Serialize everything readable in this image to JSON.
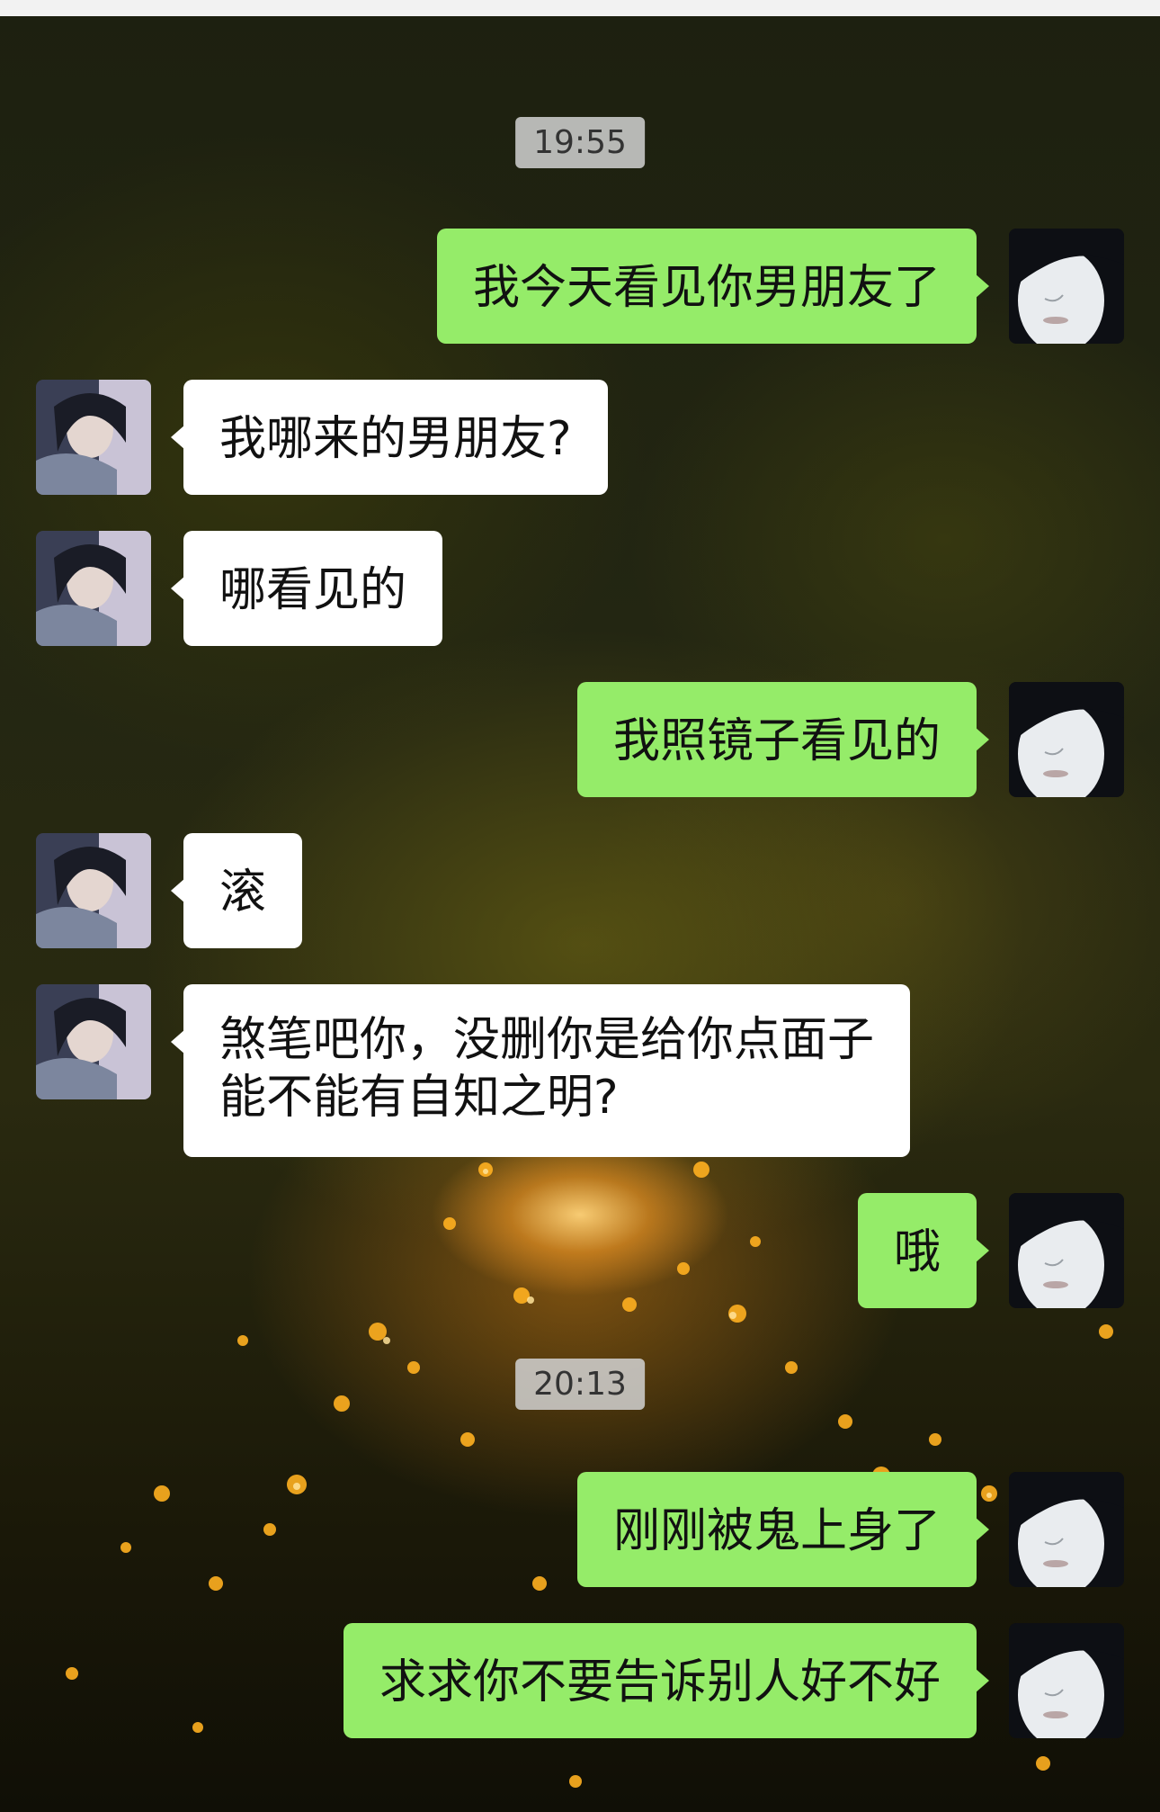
{
  "chat": {
    "timestamps": [
      "19:55",
      "20:13"
    ],
    "messages": [
      {
        "sender": "me",
        "text": "我今天看见你男朋友了"
      },
      {
        "sender": "other",
        "text": "我哪来的男朋友?"
      },
      {
        "sender": "other",
        "text": "哪看见的"
      },
      {
        "sender": "me",
        "text": "我照镜子看见的"
      },
      {
        "sender": "other",
        "text": "滚"
      },
      {
        "sender": "other",
        "lines": [
          "煞笔吧你，没删你是给你点面子",
          "能不能有自知之明?"
        ]
      },
      {
        "sender": "me",
        "text": "哦"
      },
      {
        "sender": "me",
        "text": "刚刚被鬼上身了"
      },
      {
        "sender": "me",
        "text": "求求你不要告诉别人好不好"
      }
    ]
  },
  "colors": {
    "sent_bubble": "#95ec69",
    "received_bubble": "#ffffff",
    "time_label_bg": "#d2d2d2"
  },
  "icons": {
    "my_avatar": "pale-face-avatar",
    "other_avatar": "girl-photo-avatar"
  }
}
